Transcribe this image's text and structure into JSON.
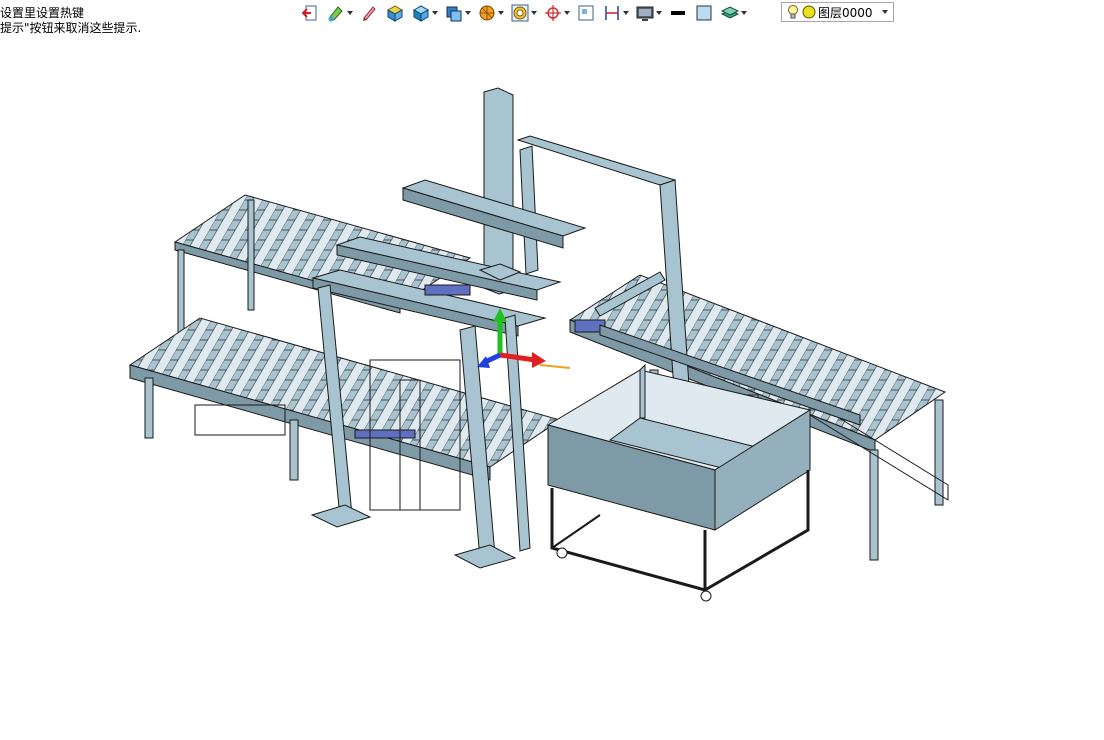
{
  "hints": {
    "line1": "设置里设置热键",
    "line2": "提示\"按钮来取消这些提示."
  },
  "toolbar": {
    "icons": [
      "exit-icon",
      "paint-icon",
      "pencil-icon",
      "box-icon",
      "cube-icon",
      "view-cube-icon",
      "sphere-icon",
      "circle-target-icon",
      "crosshair-icon",
      "frame-icon",
      "dimension-icon",
      "monitor-icon",
      "line-weight-icon",
      "color-square-icon",
      "layer-stack-icon"
    ],
    "layer_label": "图层0000"
  },
  "colors": {
    "steel": "#a8c4d0",
    "steel_dark": "#7e9aa6",
    "outline": "#1a1a1a",
    "axis_x": "#e02020",
    "axis_y": "#20c020",
    "axis_z": "#2040e0"
  }
}
